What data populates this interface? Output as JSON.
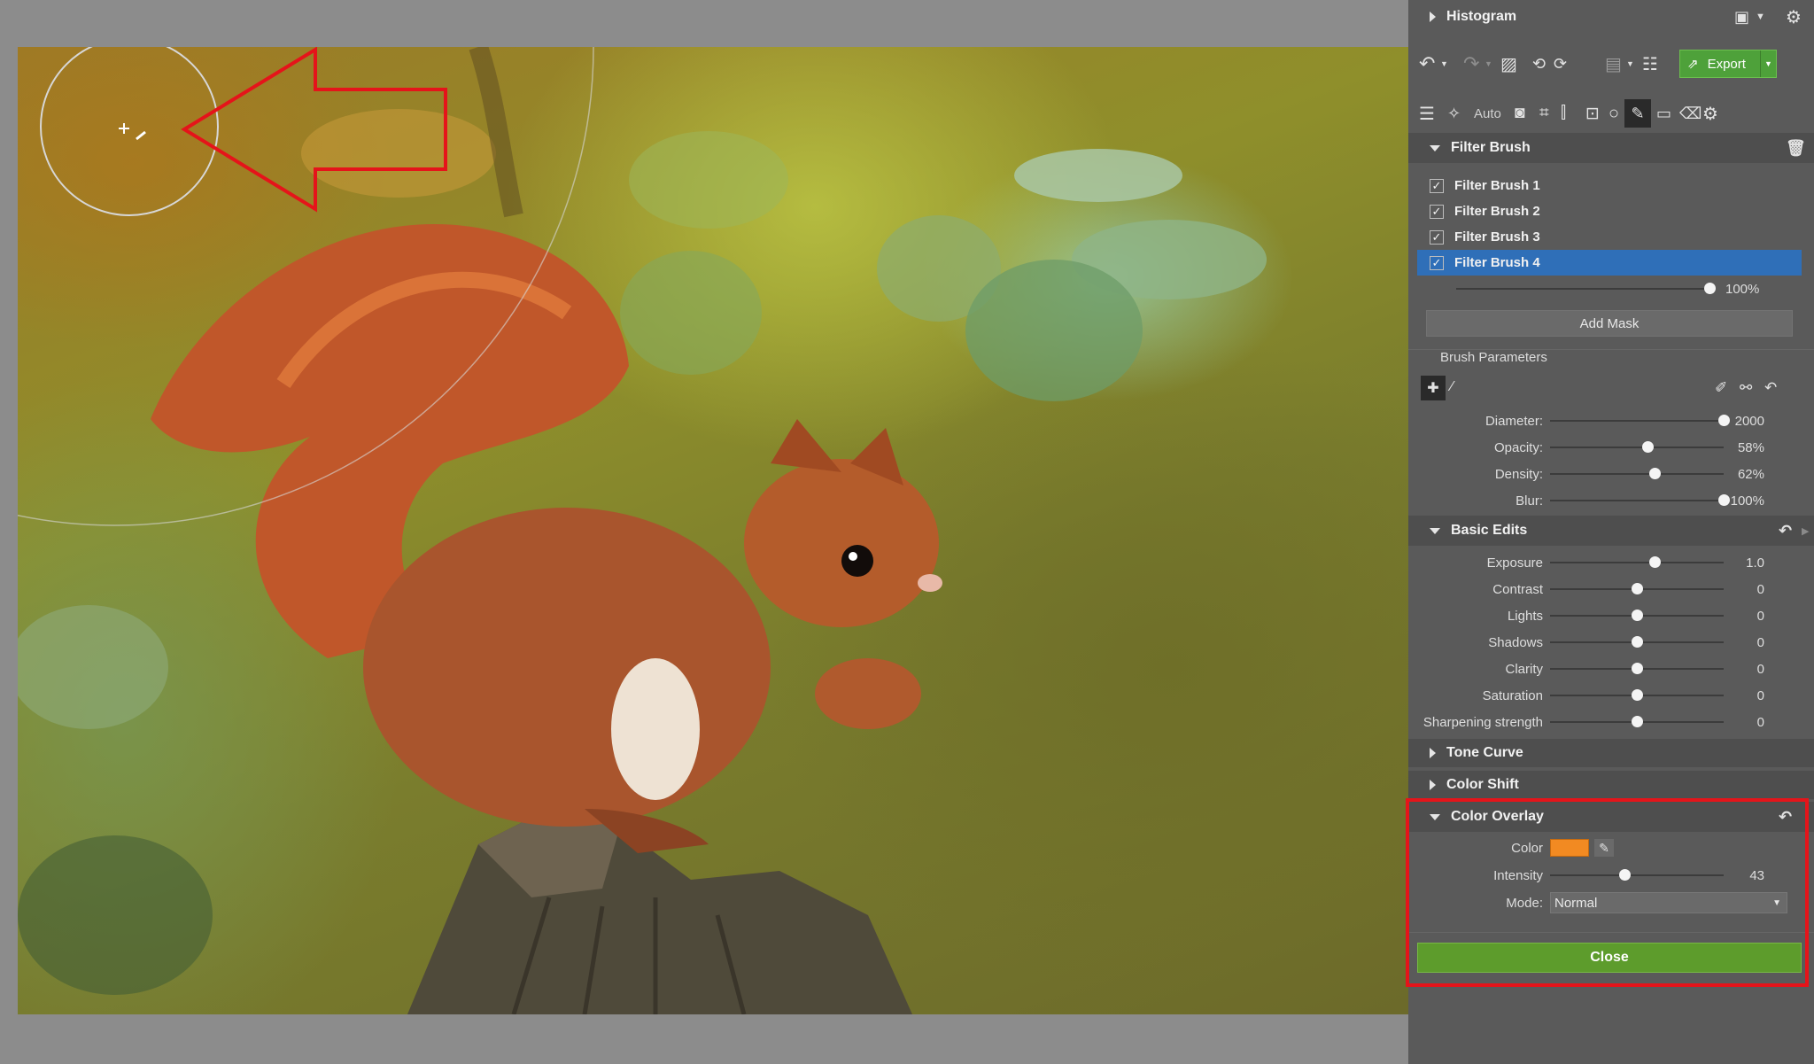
{
  "colors": {
    "accent": "#2f6fb8",
    "close_button": "#5d9c2c",
    "export_button": "#4ea13a",
    "overlay_color": "#f28a22",
    "annotation": "#e5141a"
  },
  "panel": {
    "histogram": {
      "title": "Histogram"
    },
    "toolbar": {
      "export_label": "Export"
    },
    "tools": {
      "auto_label": "Auto"
    },
    "filter_brush": {
      "title": "Filter Brush",
      "items": [
        {
          "label": "Filter Brush 1",
          "checked": true
        },
        {
          "label": "Filter Brush 2",
          "checked": true
        },
        {
          "label": "Filter Brush 3",
          "checked": true
        },
        {
          "label": "Filter Brush 4",
          "checked": true,
          "selected": true
        }
      ],
      "mask_opacity": {
        "value": "100%",
        "fraction": 1.0
      },
      "add_mask_label": "Add Mask"
    },
    "brush_parameters": {
      "title": "Brush Parameters",
      "params": [
        {
          "label": "Diameter:",
          "value": "2000",
          "fraction": 1.0
        },
        {
          "label": "Opacity:",
          "value": "58%",
          "fraction": 0.56
        },
        {
          "label": "Density:",
          "value": "62%",
          "fraction": 0.6
        },
        {
          "label": "Blur:",
          "value": "100%",
          "fraction": 1.0
        }
      ]
    },
    "basic_edits": {
      "title": "Basic Edits",
      "params": [
        {
          "label": "Exposure",
          "value": "1.0",
          "fraction": 0.6
        },
        {
          "label": "Contrast",
          "value": "0",
          "fraction": 0.5
        },
        {
          "label": "Lights",
          "value": "0",
          "fraction": 0.5
        },
        {
          "label": "Shadows",
          "value": "0",
          "fraction": 0.5
        },
        {
          "label": "Clarity",
          "value": "0",
          "fraction": 0.5
        },
        {
          "label": "Saturation",
          "value": "0",
          "fraction": 0.5
        },
        {
          "label": "Sharpening strength",
          "value": "0",
          "fraction": 0.5
        }
      ]
    },
    "tone_curve": {
      "title": "Tone Curve"
    },
    "color_shift": {
      "title": "Color Shift"
    },
    "color_overlay": {
      "title": "Color Overlay",
      "color_label": "Color",
      "intensity_label": "Intensity",
      "intensity_value": "43",
      "intensity_fraction": 0.43,
      "mode_label": "Mode:",
      "mode_value": "Normal"
    },
    "close_label": "Close"
  }
}
